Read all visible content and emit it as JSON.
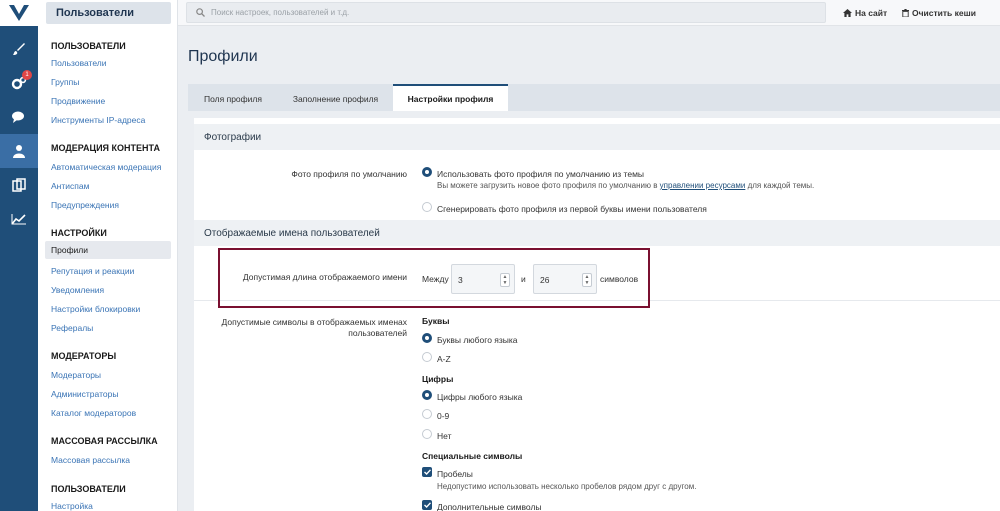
{
  "sidebar": {
    "header": "Пользователи",
    "sections": [
      {
        "title": "ПОЛЬЗОВАТЕЛИ",
        "items": [
          "Пользователи",
          "Группы",
          "Продвижение",
          "Инструменты IP-адреса"
        ]
      },
      {
        "title": "МОДЕРАЦИЯ КОНТЕНТА",
        "items": [
          "Автоматическая модерация",
          "Антиспам",
          "Предупреждения"
        ]
      },
      {
        "title": "НАСТРОЙКИ",
        "items": [
          "Профили",
          "Репутация и реакции",
          "Уведомления",
          "Настройки блокировки",
          "Рефералы"
        ]
      },
      {
        "title": "МОДЕРАТОРЫ",
        "items": [
          "Модераторы",
          "Администраторы",
          "Каталог модераторов"
        ]
      },
      {
        "title": "МАССОВАЯ РАССЫЛКА",
        "items": [
          "Массовая рассылка"
        ]
      },
      {
        "title": "ПОЛЬЗОВАТЕЛИ",
        "items": [
          "Настройка"
        ]
      }
    ]
  },
  "rail": {
    "badge": "1"
  },
  "topbar": {
    "search_placeholder": "Поиск настроек, пользователей и т.д.",
    "to_site": "На сайт",
    "clear_cache": "Очистить кеши"
  },
  "page": {
    "title": "Профили",
    "tabs": [
      "Поля профиля",
      "Заполнение профиля",
      "Настройки профиля"
    ]
  },
  "photos": {
    "heading": "Фотографии",
    "label": "Фото профиля по умолчанию",
    "option1": "Использовать фото профиля по умолчанию из темы",
    "hint_before": "Вы можете загрузить новое фото профиля по умолчанию в ",
    "hint_link": "управлении ресурсами",
    "hint_after": " для каждой темы.",
    "option2": "Сгенерировать фото профиля из первой буквы имени пользователя"
  },
  "names": {
    "heading": "Отображаемые имена пользователей",
    "length_label": "Допустимая длина отображаемого имени",
    "between": "Между",
    "min": "3",
    "and": "и",
    "max": "26",
    "unit": "символов",
    "chars_label": "Допустимые символы в отображаемых именах пользователей",
    "letters_head": "Буквы",
    "letters_any": "Буквы любого языка",
    "letters_az": "A-Z",
    "digits_head": "Цифры",
    "digits_any": "Цифры любого языка",
    "digits_09": "0-9",
    "digits_no": "Нет",
    "special_head": "Специальные символы",
    "spaces": "Пробелы",
    "spaces_hint": "Недопустимо использовать несколько пробелов рядом друг с другом.",
    "extra": "Дополнительные символы"
  }
}
